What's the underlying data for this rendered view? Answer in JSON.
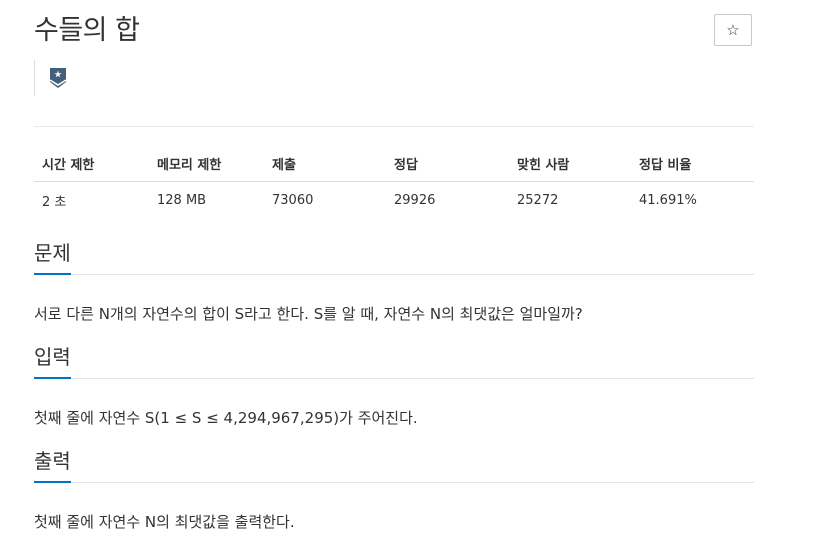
{
  "problem": {
    "title": "수들의 합",
    "star_icon": "☆"
  },
  "info_table": {
    "headers": [
      "시간 제한",
      "메모리 제한",
      "제출",
      "정답",
      "맞힌 사람",
      "정답 비율"
    ],
    "row": [
      "2 초",
      "128 MB",
      "73060",
      "29926",
      "25272",
      "41.691%"
    ]
  },
  "sections": {
    "description": {
      "title": "문제",
      "body": "서로 다른 N개의 자연수의 합이 S라고 한다. S를 알 때, 자연수 N의 최댓값은 얼마일까?"
    },
    "input": {
      "title": "입력",
      "body": "첫째 줄에 자연수 S(1 ≤ S ≤ 4,294,967,295)가 주어진다."
    },
    "output": {
      "title": "출력",
      "body": "첫째 줄에 자연수 N의 최댓값을 출력한다."
    }
  },
  "colors": {
    "accent": "#0076c0",
    "tier_badge": "#435f7a"
  }
}
